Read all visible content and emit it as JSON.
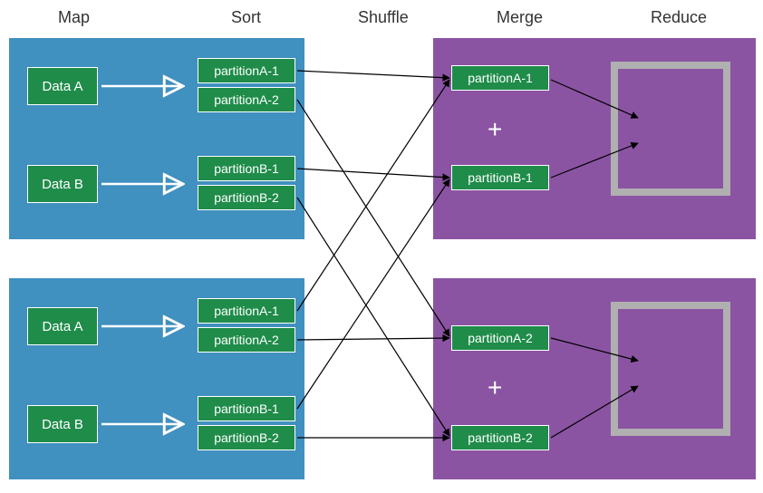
{
  "headers": {
    "map": "Map",
    "sort": "Sort",
    "shuffle": "Shuffle",
    "merge": "Merge",
    "reduce": "Reduce"
  },
  "map_panels": [
    {
      "data_blocks": [
        {
          "label": "Data A",
          "partitions": [
            "partitionA-1",
            "partitionA-2"
          ]
        },
        {
          "label": "Data B",
          "partitions": [
            "partitionB-1",
            "partitionB-2"
          ]
        }
      ]
    },
    {
      "data_blocks": [
        {
          "label": "Data A",
          "partitions": [
            "partitionA-1",
            "partitionA-2"
          ]
        },
        {
          "label": "Data B",
          "partitions": [
            "partitionB-1",
            "partitionB-2"
          ]
        }
      ]
    }
  ],
  "merge_panels": [
    {
      "partitions": [
        "partitionA-1",
        "partitionB-1"
      ],
      "operator": "+"
    },
    {
      "partitions": [
        "partitionA-2",
        "partitionB-2"
      ],
      "operator": "+"
    }
  ],
  "colors": {
    "blue": "#4090c0",
    "purple": "#8b54a3",
    "green": "#1f8c4a",
    "grey": "#b0b0b0"
  }
}
